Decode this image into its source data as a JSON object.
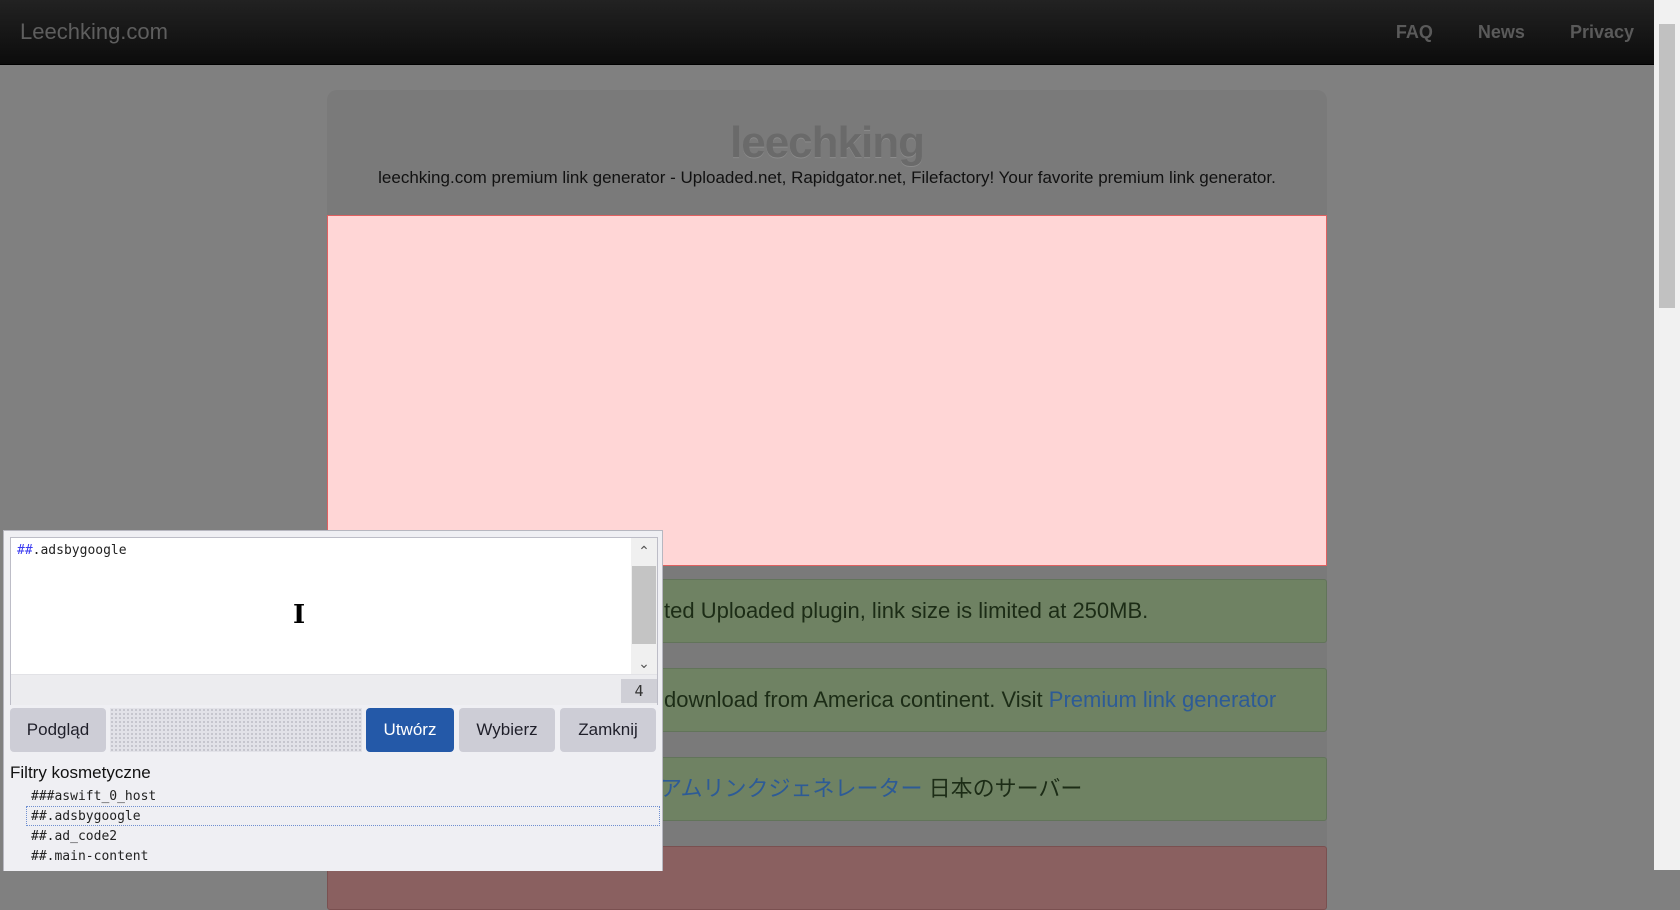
{
  "navbar": {
    "brand": "Leechking.com",
    "links": [
      "FAQ",
      "News",
      "Privacy"
    ]
  },
  "main": {
    "logo": "leechking",
    "tagline": "leechking.com premium link generator - Uploaded.net, Rapidgator.net, Filefactory! Your favorite premium link generator.",
    "alerts": [
      {
        "text": "ted Uploaded plugin, link size is limited at 250MB."
      },
      {
        "text": "download from America continent. Visit ",
        "link": "Premium link generator"
      },
      {
        "link": "ミアムリンクジェネレーター",
        "text": " 日本のサーバー"
      },
      {
        "text": ""
      }
    ]
  },
  "popup": {
    "editor": {
      "hash": "##",
      "selector": ".adsbygoogle",
      "count": "4"
    },
    "buttons": {
      "preview": "Podgląd",
      "create": "Utwórz",
      "pick": "Wybierz",
      "close": "Zamknij"
    },
    "filters_title": "Filtry kosmetyczne",
    "filters": [
      "###aswift_0_host",
      "##.adsbygoogle",
      "##.ad_code2",
      "##.main-content"
    ],
    "selected_filter_index": 1
  },
  "colors": {
    "accent_button": "#2459a8",
    "ad_highlight": "#ffd6d6",
    "alert_green": "#6f8263"
  }
}
